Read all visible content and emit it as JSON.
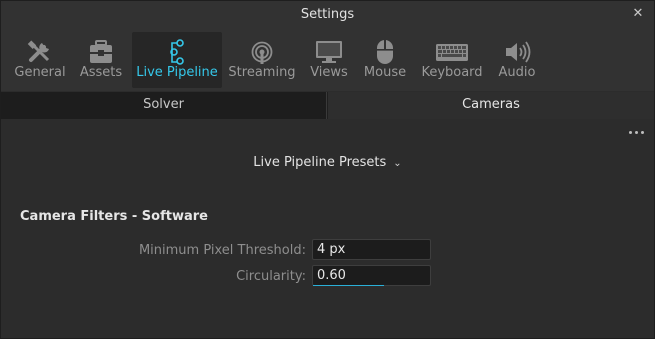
{
  "window": {
    "title": "Settings",
    "close_glyph": "✕"
  },
  "toolbar": {
    "items": [
      {
        "label": "General",
        "icon": "tools-icon",
        "active": false
      },
      {
        "label": "Assets",
        "icon": "assets-icon",
        "active": false
      },
      {
        "label": "Live Pipeline",
        "icon": "pipeline-icon",
        "active": true
      },
      {
        "label": "Streaming",
        "icon": "streaming-icon",
        "active": false
      },
      {
        "label": "Views",
        "icon": "monitor-icon",
        "active": false
      },
      {
        "label": "Mouse",
        "icon": "mouse-icon",
        "active": false
      },
      {
        "label": "Keyboard",
        "icon": "keyboard-icon",
        "active": false
      },
      {
        "label": "Audio",
        "icon": "speaker-icon",
        "active": false
      }
    ],
    "accent_color": "#35c8ea"
  },
  "tabs": [
    {
      "label": "Solver",
      "selected": false
    },
    {
      "label": "Cameras",
      "selected": true
    }
  ],
  "content": {
    "presets_label": "Live Pipeline Presets",
    "section_title": "Camera Filters - Software",
    "fields": [
      {
        "label": "Minimum Pixel Threshold:",
        "value": "4 px"
      },
      {
        "label": "Circularity:",
        "value": "0.60"
      }
    ]
  }
}
